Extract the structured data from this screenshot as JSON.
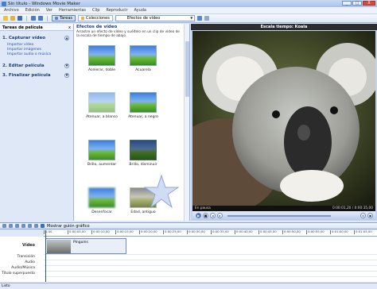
{
  "window": {
    "title": "Sin título - Windows Movie Maker",
    "min_label": "_",
    "max_label": "□",
    "close_label": "X"
  },
  "menu": [
    "Archivo",
    "Edición",
    "Ver",
    "Herramientas",
    "Clip",
    "Reproducir",
    "Ayuda"
  ],
  "toolbar": {
    "tasks_label": "Tareas",
    "collections_label": "Colecciones",
    "collection_select": "Efectos de vídeo"
  },
  "tasks_pane": {
    "title": "Tareas de película",
    "close": "x",
    "sections": [
      {
        "title": "1. Capturar vídeo",
        "links": [
          "Importar vídeo",
          "Importar imágenes",
          "Importar audio o música"
        ]
      },
      {
        "title": "2. Editar película",
        "links": []
      },
      {
        "title": "3. Finalizar película",
        "links": []
      }
    ]
  },
  "collection": {
    "title": "Efectos de vídeo",
    "description": "Arrastre un efecto de vídeo y suéltelo en un clip de vídeo de la escala de tiempo de abajo.",
    "effects": [
      "Acelerar, doble",
      "Acuarela",
      "Atenuar, a blanco",
      "Atenuar, a negro",
      "Brillo, aumentar",
      "Brillo, disminuir",
      "Desenfocar",
      "Edad, antiguo"
    ]
  },
  "monitor": {
    "title": "Escala tiempo: Koala",
    "status": "En pausa",
    "time": "0:00:01,20 / 0:00:35,00"
  },
  "storyboard": {
    "toggle_label": "Mostrar guión gráfico",
    "ruler": [
      "0,00",
      "0:00:05,00",
      "0:00:10,00",
      "0:00:15,00",
      "0:00:20,00",
      "0:00:25,00",
      "0:00:30,00",
      "0:00:35,00",
      "0:00:40,00",
      "0:00:45,00",
      "0:00:50,00",
      "0:00:55,00",
      "0:01:00,00",
      "0:01:05,00"
    ],
    "tracks": [
      "Vídeo",
      "Transición",
      "Audio",
      "Audio/Música",
      "Título superpuesto"
    ],
    "clip_name": "Pinguins"
  },
  "statusbar": "Listo",
  "colors": {
    "accent": "#3a6fc4",
    "panel_bg": "#dfe8f6",
    "link": "#2850a8"
  }
}
